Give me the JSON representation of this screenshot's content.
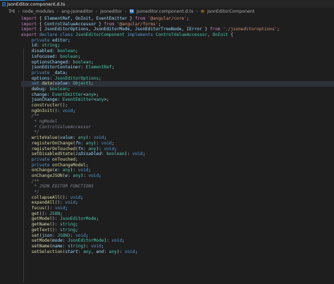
{
  "tab": {
    "label": "jsonEditor.component.d.ts"
  },
  "breadcrumb": [
    "Tr6",
    "node_modules",
    "ang-jsoneditor",
    "jsoneditor",
    "jsoneditor.component.d.ts",
    "JsonEditorComponent"
  ],
  "colors": {
    "background": "#1e1e1e",
    "keyword": "#c586c0",
    "storage": "#569cd6",
    "type": "#4ec9b0",
    "function": "#dcdcaa",
    "property": "#9cdcfe",
    "string": "#ce9178",
    "comment": "#6a9955"
  },
  "code_lines": [
    [
      [
        "kw",
        "import"
      ],
      [
        "plain",
        " { "
      ],
      [
        "var",
        "ElementRef"
      ],
      [
        "plain",
        ", "
      ],
      [
        "var",
        "OnInit"
      ],
      [
        "plain",
        ", "
      ],
      [
        "var",
        "EventEmitter"
      ],
      [
        "plain",
        " } "
      ],
      [
        "kw",
        "from"
      ],
      [
        "plain",
        " "
      ],
      [
        "str",
        "'@angular/core'"
      ],
      [
        "plain",
        ";"
      ]
    ],
    [
      [
        "kw",
        "import"
      ],
      [
        "plain",
        " { "
      ],
      [
        "var",
        "ControlValueAccessor"
      ],
      [
        "plain",
        " } "
      ],
      [
        "kw",
        "from"
      ],
      [
        "plain",
        " "
      ],
      [
        "str",
        "'@angular/forms'"
      ],
      [
        "plain",
        ";"
      ]
    ],
    [
      [
        "kw",
        "import"
      ],
      [
        "plain",
        " { "
      ],
      [
        "var",
        "JsonEditorOptions"
      ],
      [
        "plain",
        ", "
      ],
      [
        "var",
        "JsonEditorMode"
      ],
      [
        "plain",
        ", "
      ],
      [
        "var",
        "JsonEditorTreeNode"
      ],
      [
        "plain",
        ", "
      ],
      [
        "var",
        "IError"
      ],
      [
        "plain",
        " } "
      ],
      [
        "kw",
        "from"
      ],
      [
        "plain",
        " "
      ],
      [
        "str",
        "'./jsoneditoroptions'"
      ],
      [
        "plain",
        ";"
      ]
    ],
    [
      [
        "kw",
        "export"
      ],
      [
        "plain",
        " "
      ],
      [
        "kw2",
        "declare"
      ],
      [
        "plain",
        " "
      ],
      [
        "kw2",
        "class"
      ],
      [
        "plain",
        " "
      ],
      [
        "cls",
        "JsonEditorComponent"
      ],
      [
        "plain",
        " "
      ],
      [
        "kw2",
        "implements"
      ],
      [
        "plain",
        " "
      ],
      [
        "cls",
        "ControlValueAccessor"
      ],
      [
        "plain",
        ", "
      ],
      [
        "cls",
        "OnInit"
      ],
      [
        "plain",
        " {"
      ]
    ],
    [
      [
        "plain",
        "    "
      ],
      [
        "kw2",
        "private"
      ],
      [
        "plain",
        " "
      ],
      [
        "var",
        "editor"
      ],
      [
        "plain",
        ";"
      ]
    ],
    [
      [
        "plain",
        "    "
      ],
      [
        "var",
        "id"
      ],
      [
        "plain",
        ": "
      ],
      [
        "cls",
        "string"
      ],
      [
        "plain",
        ";"
      ]
    ],
    [
      [
        "plain",
        "    "
      ],
      [
        "var",
        "disabled"
      ],
      [
        "plain",
        ": "
      ],
      [
        "cls",
        "boolean"
      ],
      [
        "plain",
        ";"
      ]
    ],
    [
      [
        "plain",
        "    "
      ],
      [
        "var",
        "isFocused"
      ],
      [
        "plain",
        ": "
      ],
      [
        "cls",
        "boolean"
      ],
      [
        "plain",
        ";"
      ]
    ],
    [
      [
        "plain",
        "    "
      ],
      [
        "var",
        "optionsChanged"
      ],
      [
        "plain",
        ": "
      ],
      [
        "cls",
        "boolean"
      ],
      [
        "plain",
        ";"
      ]
    ],
    [
      [
        "plain",
        "    "
      ],
      [
        "var",
        "jsonEditorContainer"
      ],
      [
        "plain",
        ": "
      ],
      [
        "cls",
        "ElementRef"
      ],
      [
        "plain",
        ";"
      ]
    ],
    [
      [
        "plain",
        "    "
      ],
      [
        "kw2",
        "private"
      ],
      [
        "plain",
        " "
      ],
      [
        "var",
        "_data"
      ],
      [
        "plain",
        ";"
      ]
    ],
    [
      [
        "plain",
        "    "
      ],
      [
        "var",
        "options"
      ],
      [
        "plain",
        ": "
      ],
      [
        "cls",
        "JsonEditorOptions"
      ],
      [
        "plain",
        ";"
      ]
    ],
    [
      [
        "plain",
        "    "
      ],
      [
        "kw2",
        "set"
      ],
      [
        "plain",
        " "
      ],
      [
        "fn",
        "data"
      ],
      [
        "plain",
        "("
      ],
      [
        "prm",
        "value"
      ],
      [
        "plain",
        ": "
      ],
      [
        "cls",
        "Object"
      ],
      [
        "plain",
        ");"
      ]
    ],
    [
      [
        "plain",
        "    "
      ],
      [
        "var",
        "debug"
      ],
      [
        "plain",
        ": "
      ],
      [
        "cls",
        "boolean"
      ],
      [
        "plain",
        ";"
      ]
    ],
    [
      [
        "plain",
        "    "
      ],
      [
        "var",
        "change"
      ],
      [
        "plain",
        ": "
      ],
      [
        "cls",
        "EventEmitter"
      ],
      [
        "plain",
        "<"
      ],
      [
        "cls",
        "any"
      ],
      [
        "plain",
        ">;"
      ]
    ],
    [
      [
        "plain",
        "    "
      ],
      [
        "var",
        "jsonChange"
      ],
      [
        "plain",
        ": "
      ],
      [
        "cls",
        "EventEmitter"
      ],
      [
        "plain",
        "<"
      ],
      [
        "cls",
        "any"
      ],
      [
        "plain",
        ">;"
      ]
    ],
    [
      [
        "plain",
        "    "
      ],
      [
        "fn",
        "constructor"
      ],
      [
        "plain",
        "();"
      ]
    ],
    [
      [
        "plain",
        "    "
      ],
      [
        "fn",
        "ngOnInit"
      ],
      [
        "plain",
        "(): "
      ],
      [
        "kw2",
        "void"
      ],
      [
        "plain",
        ";"
      ]
    ],
    [
      [
        "plain",
        "    "
      ],
      [
        "cmt2",
        "/**"
      ]
    ],
    [
      [
        "plain",
        "    "
      ],
      [
        "cmt2",
        " * ngModel"
      ]
    ],
    [
      [
        "plain",
        "    "
      ],
      [
        "cmt2",
        " * ControlValueAccessor"
      ]
    ],
    [
      [
        "plain",
        "    "
      ],
      [
        "cmt2",
        " */"
      ]
    ],
    [
      [
        "plain",
        "    "
      ],
      [
        "fn",
        "writeValue"
      ],
      [
        "plain",
        "("
      ],
      [
        "prm",
        "value"
      ],
      [
        "plain",
        ": "
      ],
      [
        "cls",
        "any"
      ],
      [
        "plain",
        "): "
      ],
      [
        "kw2",
        "void"
      ],
      [
        "plain",
        ";"
      ]
    ],
    [
      [
        "plain",
        "    "
      ],
      [
        "fn",
        "registerOnChange"
      ],
      [
        "plain",
        "("
      ],
      [
        "prm",
        "fn"
      ],
      [
        "plain",
        ": "
      ],
      [
        "cls",
        "any"
      ],
      [
        "plain",
        "): "
      ],
      [
        "kw2",
        "void"
      ],
      [
        "plain",
        ";"
      ]
    ],
    [
      [
        "plain",
        "    "
      ],
      [
        "fn",
        "registerOnTouched"
      ],
      [
        "plain",
        "("
      ],
      [
        "prm",
        "fn"
      ],
      [
        "plain",
        ": "
      ],
      [
        "cls",
        "any"
      ],
      [
        "plain",
        "): "
      ],
      [
        "kw2",
        "void"
      ],
      [
        "plain",
        ";"
      ]
    ],
    [
      [
        "plain",
        "    "
      ],
      [
        "fn",
        "setDisabledState"
      ],
      [
        "plain",
        "("
      ],
      [
        "prm",
        "isDisabled"
      ],
      [
        "plain",
        ": "
      ],
      [
        "cls",
        "boolean"
      ],
      [
        "plain",
        "): "
      ],
      [
        "kw2",
        "void"
      ],
      [
        "plain",
        ";"
      ]
    ],
    [
      [
        "plain",
        "    "
      ],
      [
        "kw2",
        "private"
      ],
      [
        "plain",
        " "
      ],
      [
        "fn",
        "onTouched"
      ],
      [
        "plain",
        ";"
      ]
    ],
    [
      [
        "plain",
        "    "
      ],
      [
        "kw2",
        "private"
      ],
      [
        "plain",
        " "
      ],
      [
        "fn",
        "onChangeModel"
      ],
      [
        "plain",
        ";"
      ]
    ],
    [
      [
        "plain",
        "    "
      ],
      [
        "fn",
        "onChange"
      ],
      [
        "plain",
        "("
      ],
      [
        "prm",
        "e"
      ],
      [
        "plain",
        ": "
      ],
      [
        "cls",
        "any"
      ],
      [
        "plain",
        "): "
      ],
      [
        "kw2",
        "void"
      ],
      [
        "plain",
        ";"
      ]
    ],
    [
      [
        "plain",
        "    "
      ],
      [
        "fn",
        "onChangeJSON"
      ],
      [
        "plain",
        "("
      ],
      [
        "prm",
        "e"
      ],
      [
        "plain",
        ": "
      ],
      [
        "cls",
        "any"
      ],
      [
        "plain",
        "): "
      ],
      [
        "kw2",
        "void"
      ],
      [
        "plain",
        ";"
      ]
    ],
    [
      [
        "plain",
        "    "
      ],
      [
        "cmt2",
        "/**"
      ]
    ],
    [
      [
        "plain",
        "    "
      ],
      [
        "cmt2",
        " * JSON EDITOR FUNCTIONS"
      ]
    ],
    [
      [
        "plain",
        "    "
      ],
      [
        "cmt2",
        " */"
      ]
    ],
    [
      [
        "plain",
        "    "
      ],
      [
        "fn",
        "collapseAll"
      ],
      [
        "plain",
        "(): "
      ],
      [
        "kw2",
        "void"
      ],
      [
        "plain",
        ";"
      ]
    ],
    [
      [
        "plain",
        "    "
      ],
      [
        "fn",
        "expandAll"
      ],
      [
        "plain",
        "(): "
      ],
      [
        "kw2",
        "void"
      ],
      [
        "plain",
        ";"
      ]
    ],
    [
      [
        "plain",
        "    "
      ],
      [
        "fn",
        "focus"
      ],
      [
        "plain",
        "(): "
      ],
      [
        "kw2",
        "void"
      ],
      [
        "plain",
        ";"
      ]
    ],
    [
      [
        "plain",
        "    "
      ],
      [
        "fn",
        "get"
      ],
      [
        "plain",
        "(): "
      ],
      [
        "cls",
        "JSON"
      ],
      [
        "plain",
        ";"
      ]
    ],
    [
      [
        "plain",
        "    "
      ],
      [
        "fn",
        "getMode"
      ],
      [
        "plain",
        "(): "
      ],
      [
        "cls",
        "JsonEditorMode"
      ],
      [
        "plain",
        ";"
      ]
    ],
    [
      [
        "plain",
        "    "
      ],
      [
        "fn",
        "getName"
      ],
      [
        "plain",
        "(): "
      ],
      [
        "cls",
        "string"
      ],
      [
        "plain",
        ";"
      ]
    ],
    [
      [
        "plain",
        "    "
      ],
      [
        "fn",
        "getText"
      ],
      [
        "plain",
        "(): "
      ],
      [
        "cls",
        "string"
      ],
      [
        "plain",
        ";"
      ]
    ],
    [
      [
        "plain",
        "    "
      ],
      [
        "fn",
        "set"
      ],
      [
        "plain",
        "("
      ],
      [
        "prm",
        "json"
      ],
      [
        "plain",
        ": "
      ],
      [
        "cls",
        "JSON"
      ],
      [
        "plain",
        "): "
      ],
      [
        "kw2",
        "void"
      ],
      [
        "plain",
        ";"
      ]
    ],
    [
      [
        "plain",
        "    "
      ],
      [
        "fn",
        "setMode"
      ],
      [
        "plain",
        "("
      ],
      [
        "prm",
        "mode"
      ],
      [
        "plain",
        ": "
      ],
      [
        "cls",
        "JsonEditorMode"
      ],
      [
        "plain",
        "): "
      ],
      [
        "kw2",
        "void"
      ],
      [
        "plain",
        ";"
      ]
    ],
    [
      [
        "plain",
        "    "
      ],
      [
        "fn",
        "setName"
      ],
      [
        "plain",
        "("
      ],
      [
        "prm",
        "name"
      ],
      [
        "plain",
        ": "
      ],
      [
        "cls",
        "string"
      ],
      [
        "plain",
        "): "
      ],
      [
        "kw2",
        "void"
      ],
      [
        "plain",
        ";"
      ]
    ],
    [
      [
        "plain",
        "    "
      ],
      [
        "fn",
        "setSelection"
      ],
      [
        "plain",
        "("
      ],
      [
        "prm",
        "start"
      ],
      [
        "plain",
        ": "
      ],
      [
        "cls",
        "any"
      ],
      [
        "plain",
        ", "
      ],
      [
        "prm",
        "end"
      ],
      [
        "plain",
        ": "
      ],
      [
        "cls",
        "any"
      ],
      [
        "plain",
        "): "
      ],
      [
        "kw2",
        "void"
      ],
      [
        "plain",
        ";"
      ]
    ]
  ],
  "highlighted_line": 12
}
